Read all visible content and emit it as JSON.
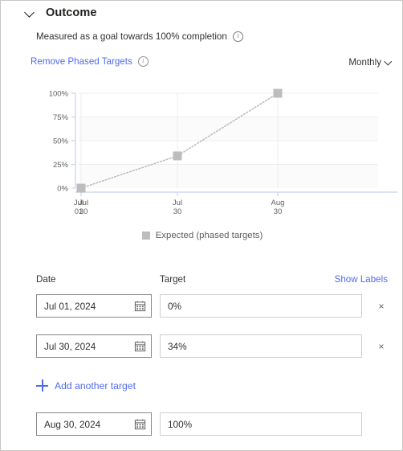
{
  "header": {
    "title": "Outcome",
    "collapse_icon": "chevron-down-icon",
    "subtitle": "Measured as a goal towards 100% completion",
    "subtitle_info_icon": "info-icon",
    "remove_link": "Remove Phased Targets",
    "remove_link_info_icon": "info-icon",
    "cadence_value": "Monthly",
    "cadence_icon": "chevron-down-icon"
  },
  "chart_data": {
    "type": "line",
    "title": "",
    "xlabel": "",
    "ylabel": "",
    "x": [
      "Jul 01",
      "Jul 30",
      "Aug 30"
    ],
    "x_tick_labels": [
      {
        "line1": "Jul",
        "line2": "01"
      },
      {
        "line1": "Jul",
        "line2": "30"
      },
      {
        "line1": "Jul",
        "line2": "30"
      },
      {
        "line1": "Aug",
        "line2": "30"
      }
    ],
    "x_tick_overlap_note": "first two labels overlap at the same tick position",
    "y_tick_labels": [
      "0%",
      "25%",
      "50%",
      "75%",
      "100%"
    ],
    "ylim": [
      0,
      100
    ],
    "grid": true,
    "legend_position": "bottom",
    "series": [
      {
        "name": "Expected (phased targets)",
        "values": [
          0,
          34,
          100
        ],
        "color": "#bdbdbd",
        "line_style": "dotted",
        "marker": "square"
      }
    ]
  },
  "table": {
    "columns": {
      "date": "Date",
      "target": "Target"
    },
    "show_labels": "Show Labels",
    "rows": [
      {
        "date": "Jul 01, 2024",
        "target": "0%",
        "calendar_icon": "calendar-icon",
        "remove": "×",
        "removable": true
      },
      {
        "date": "Jul 30, 2024",
        "target": "34%",
        "calendar_icon": "calendar-icon",
        "remove": "×",
        "removable": true
      },
      {
        "date": "Aug 30, 2024",
        "target": "100%",
        "calendar_icon": "calendar-icon",
        "remove": "",
        "removable": false
      }
    ],
    "add_label": "Add another target",
    "add_icon": "plus-icon"
  },
  "colors": {
    "link": "#4f6bed",
    "series": "#bdbdbd",
    "text": "#323130",
    "border": "#8a8886"
  }
}
